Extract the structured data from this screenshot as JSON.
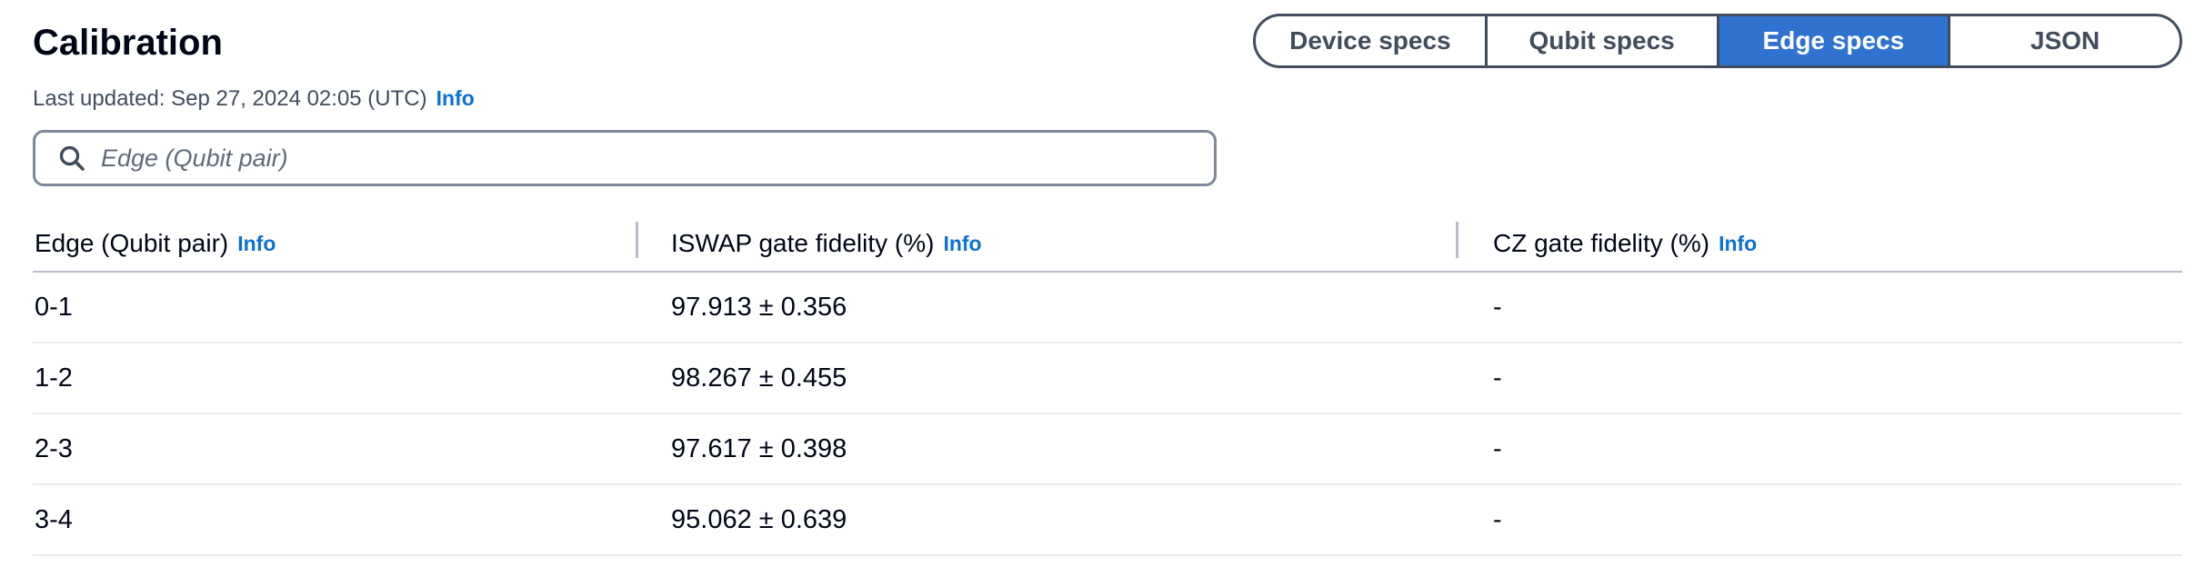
{
  "page": {
    "title": "Calibration",
    "last_updated": "Last updated: Sep 27, 2024 02:05 (UTC)",
    "info_label": "Info"
  },
  "tabs": [
    {
      "label": "Device specs",
      "selected": false
    },
    {
      "label": "Qubit specs",
      "selected": false
    },
    {
      "label": "Edge specs",
      "selected": true
    },
    {
      "label": "JSON",
      "selected": false
    }
  ],
  "search": {
    "placeholder": "Edge (Qubit pair)",
    "value": ""
  },
  "table": {
    "columns": [
      {
        "label": "Edge (Qubit pair)",
        "info": "Info"
      },
      {
        "label": "ISWAP gate fidelity (%)",
        "info": "Info"
      },
      {
        "label": "CZ gate fidelity (%)",
        "info": "Info"
      }
    ],
    "rows": [
      [
        "0-1",
        "97.913 ± 0.356",
        "-"
      ],
      [
        "1-2",
        "98.267 ± 0.455",
        "-"
      ],
      [
        "2-3",
        "97.617 ± 0.398",
        "-"
      ],
      [
        "3-4",
        "95.062 ± 0.639",
        "-"
      ]
    ]
  },
  "colors": {
    "accent": "#0972d3",
    "selected_tab": "#2f72d0",
    "border": "#414d5c"
  },
  "icons": {
    "search": "search-icon"
  }
}
